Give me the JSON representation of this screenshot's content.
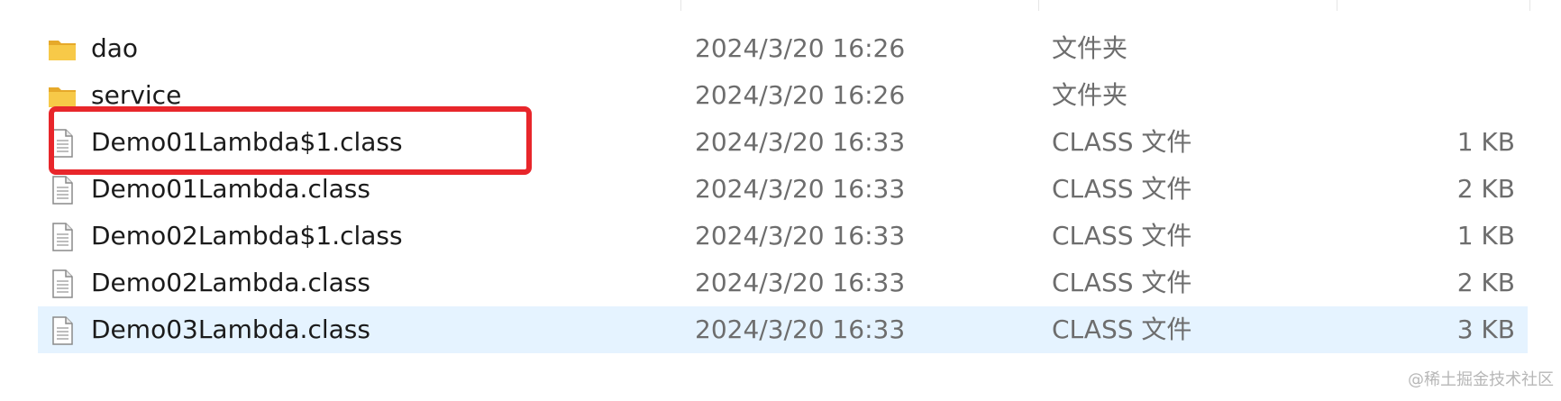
{
  "files": [
    {
      "name": "dao",
      "date": "2024/3/20 16:26",
      "type": "文件夹",
      "size": "",
      "icon": "folder-icon",
      "selected": false
    },
    {
      "name": "service",
      "date": "2024/3/20 16:26",
      "type": "文件夹",
      "size": "",
      "icon": "folder-icon",
      "selected": false
    },
    {
      "name": "Demo01Lambda$1.class",
      "date": "2024/3/20 16:33",
      "type": "CLASS 文件",
      "size": "1 KB",
      "icon": "document-icon",
      "selected": false
    },
    {
      "name": "Demo01Lambda.class",
      "date": "2024/3/20 16:33",
      "type": "CLASS 文件",
      "size": "2 KB",
      "icon": "document-icon",
      "selected": false
    },
    {
      "name": "Demo02Lambda$1.class",
      "date": "2024/3/20 16:33",
      "type": "CLASS 文件",
      "size": "1 KB",
      "icon": "document-icon",
      "selected": false
    },
    {
      "name": "Demo02Lambda.class",
      "date": "2024/3/20 16:33",
      "type": "CLASS 文件",
      "size": "2 KB",
      "icon": "document-icon",
      "selected": false
    },
    {
      "name": "Demo03Lambda.class",
      "date": "2024/3/20 16:33",
      "type": "CLASS 文件",
      "size": "3 KB",
      "icon": "document-icon",
      "selected": true
    }
  ],
  "colors": {
    "selection_background": "#e5f3ff",
    "annotation_box": "#e8262b",
    "folder": "#f5c342"
  },
  "watermark": "@稀土掘金技术社区"
}
